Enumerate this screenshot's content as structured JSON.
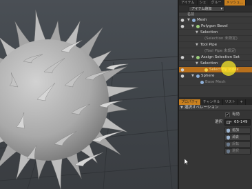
{
  "top_tabs": [
    "アイテム",
    "シェ",
    "グルー",
    "メッシュ..."
  ],
  "top_tabs_active_index": 3,
  "toolbar": {
    "add_item": "アイテム追加"
  },
  "tree_header": {
    "label": "名前"
  },
  "tree_rows": [
    {
      "label": "Mesh",
      "depth": 0,
      "eye": true,
      "arrow": "▼",
      "icon": "mesh-icon",
      "dim": false,
      "selected": false
    },
    {
      "label": "Polygon Bevel",
      "depth": 1,
      "eye": true,
      "arrow": "▼",
      "icon": "tool-icon",
      "dim": false,
      "selected": false
    },
    {
      "label": "Selection",
      "depth": 2,
      "eye": false,
      "arrow": "▼",
      "icon": "",
      "dim": false,
      "selected": false
    },
    {
      "label": "(Selection 未設定)",
      "depth": 3,
      "eye": false,
      "arrow": "",
      "icon": "",
      "dim": true,
      "selected": false
    },
    {
      "label": "Tool Pipe",
      "depth": 2,
      "eye": false,
      "arrow": "▼",
      "icon": "",
      "dim": false,
      "selected": false
    },
    {
      "label": "(Tool Pipe 未設定)",
      "depth": 3,
      "eye": false,
      "arrow": "",
      "icon": "",
      "dim": true,
      "selected": false
    },
    {
      "label": "Assign Selection Set",
      "depth": 1,
      "eye": true,
      "arrow": "▼",
      "icon": "tool-icon",
      "dim": false,
      "selected": false
    },
    {
      "label": "Selection",
      "depth": 2,
      "eye": false,
      "arrow": "▼",
      "icon": "",
      "dim": false,
      "selected": false
    },
    {
      "label": "Select By Index",
      "depth": 3,
      "eye": true,
      "arrow": "",
      "icon": "select-icon",
      "dim": false,
      "selected": true
    },
    {
      "label": "Sphere",
      "depth": 1,
      "eye": true,
      "arrow": "▼",
      "icon": "mesh-icon",
      "dim": false,
      "selected": false
    },
    {
      "label": "Base Mesh",
      "depth": 2,
      "eye": false,
      "arrow": "",
      "icon": "mesh-icon",
      "dim": true,
      "selected": false
    }
  ],
  "prop_tabs": [
    "プロパティ",
    "チャンネル",
    "リスト",
    "+"
  ],
  "prop_tabs_active_index": 0,
  "properties": {
    "section_title": "選択オペレーション",
    "enable_label": "有効",
    "enable_checked": true,
    "selection_label": "選択",
    "selection_value": "65-149",
    "buttons": [
      {
        "label": "追加",
        "icon": "add-selection-icon",
        "dim": false
      },
      {
        "label": "消去",
        "icon": "remove-selection-icon",
        "dim": false
      },
      {
        "label": "反転",
        "icon": "invert-selection-icon",
        "dim": true
      },
      {
        "label": "選択",
        "icon": "select-all-icon",
        "dim": true
      }
    ]
  },
  "colors": {
    "accent_orange": "#c9801f",
    "selected_row": "#b8701c",
    "cursor_highlight": "#ffee28",
    "viewport_bg": "#454a50",
    "mesh_gray": "#b4b4b4"
  }
}
